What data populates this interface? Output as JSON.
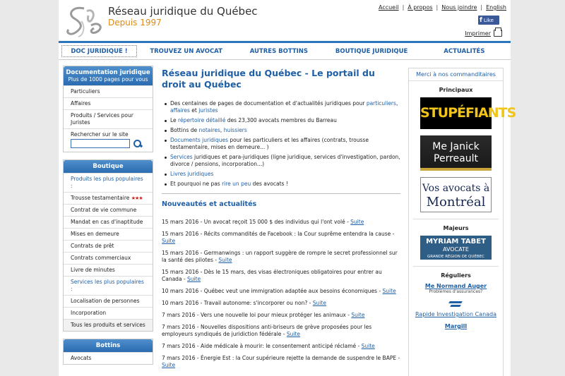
{
  "header": {
    "title": "Réseau juridique du Québec",
    "subtitle": "Depuis 1997",
    "toplinks": [
      "Accueil",
      "À propos",
      "Nous joindre",
      "English"
    ],
    "separator": "|",
    "fb_like": "Like",
    "print": "Imprimer"
  },
  "nav": [
    "DOC JURIDIQUE !",
    "TROUVEZ UN AVOCAT",
    "AUTRES BOTTINS",
    "BOUTIQUE JURIDIQUE",
    "ACTUALITÉS"
  ],
  "left": {
    "doc": {
      "title": "Documentation juridique",
      "sub": "Plus de 1000 pages pour vous",
      "items": [
        "Particuliers",
        "Affaires",
        "Produits / Services pour Juristes"
      ],
      "search_label": "Rechercher sur le site"
    },
    "boutique": {
      "title": "Boutique",
      "popular_products": "Produits les plus populaires :",
      "items": [
        "Trousse testamentaire",
        "Contrat de vie commune",
        "Mandat en cas d'inaptitude",
        "Mises en demeure",
        "Contrats de prêt",
        "Contrats commerciaux",
        "Livre de minutes"
      ],
      "stars": "★★★",
      "popular_services": "Services les plus populaires :",
      "services": [
        "Localisation de personnes",
        "Incorporation"
      ],
      "all": "Tous les produits et services"
    },
    "bottins": {
      "title": "Bottins",
      "items": [
        "Avocats"
      ]
    }
  },
  "main": {
    "title": "Réseau juridique du Québec - Le portail du droit au Québec",
    "bullets": [
      {
        "pre": "Des centaines de pages de documentation et d'actualités juridiques pour ",
        "links": [
          "particuliers",
          "affaires",
          "juristes"
        ],
        "joiners": [
          ", ",
          " et "
        ],
        "post": ""
      },
      {
        "pre": "Le ",
        "links": [
          "répertoire détaillé"
        ],
        "joiners": [],
        "post": " des 23,300 avocats membres du Barreau"
      },
      {
        "pre": "Bottins de ",
        "links": [
          "notaires",
          "huissiers"
        ],
        "joiners": [
          ", "
        ],
        "post": ""
      },
      {
        "pre": "",
        "links": [
          "Documents juridiques"
        ],
        "joiners": [],
        "post": " pour les particuliers et les affaires (contrats, trousse testamentaire, mises en demeure... )"
      },
      {
        "pre": "",
        "links": [
          "Services"
        ],
        "joiners": [],
        "post": " juridiques et para-juridiques (ligne juridique, services d'investigation, pardon, divorce / pensions, incorporation...)"
      },
      {
        "pre": "",
        "links": [
          "Livres juridiques"
        ],
        "joiners": [],
        "post": ""
      },
      {
        "pre": "Et pourquoi ne pas ",
        "links": [
          "rire un peu"
        ],
        "joiners": [],
        "post": " des avocats !"
      }
    ],
    "news_title": "Nouveautés et actualités",
    "suite": "Suite",
    "news": [
      "15 mars 2016 - Un avocat reçoit 15 000 $ des individus qui l'ont volé - ",
      "15 mars 2016 - Récits commandités de Facebook : la Cour suprême entendra la cause - ",
      "15 mars 2016 - Germanwings : un rapport suggère de rompre le secret professionnel sur la santé des pilotes - ",
      "15 mars 2016 - Dès le 15 mars, des visas électroniques obligatoires pour entrer au Canada - ",
      "10 mars 2016 - Québec veut une immigration adaptée aux besoins économiques - ",
      "10 mars 2016 - Travail autonome: s'incorporer ou non? - ",
      "7 mars 2016 - Vers une nouvelle loi pour mieux protéger les animaux - ",
      "7 mars 2016 - Nouvelles dispositions anti-briseurs de grève proposées pour les employeurs syndiqués de juridiction fédérale - ",
      "7 mars 2016 - Aide médicale à mourir: le consentement anticipé réclamé - ",
      "7 mars 2016 - Énergie Est : la Cour supérieure rejette la demande de suspendre le BAPE - "
    ]
  },
  "right": {
    "head": "Merci à nos commanditaires",
    "principaux": "Principaux",
    "ad1": "STUPÉFIANTS",
    "ad2": [
      "Me Janick",
      "Perreault"
    ],
    "ad3": [
      "Vos avocats à",
      "Montréal"
    ],
    "majeurs": "Majeurs",
    "ad4": [
      "MYRIAM TABET",
      "AVOCATE",
      "GRANDE RÉGION DE QUÉBEC"
    ],
    "reguliers": "Réguliers",
    "reg1_name": "Me Normand Auger",
    "reg1_desc": "Problèmes d'assurances?",
    "reg2_name": "Rapide Investigation Canada",
    "reg3_name": "Margill"
  }
}
